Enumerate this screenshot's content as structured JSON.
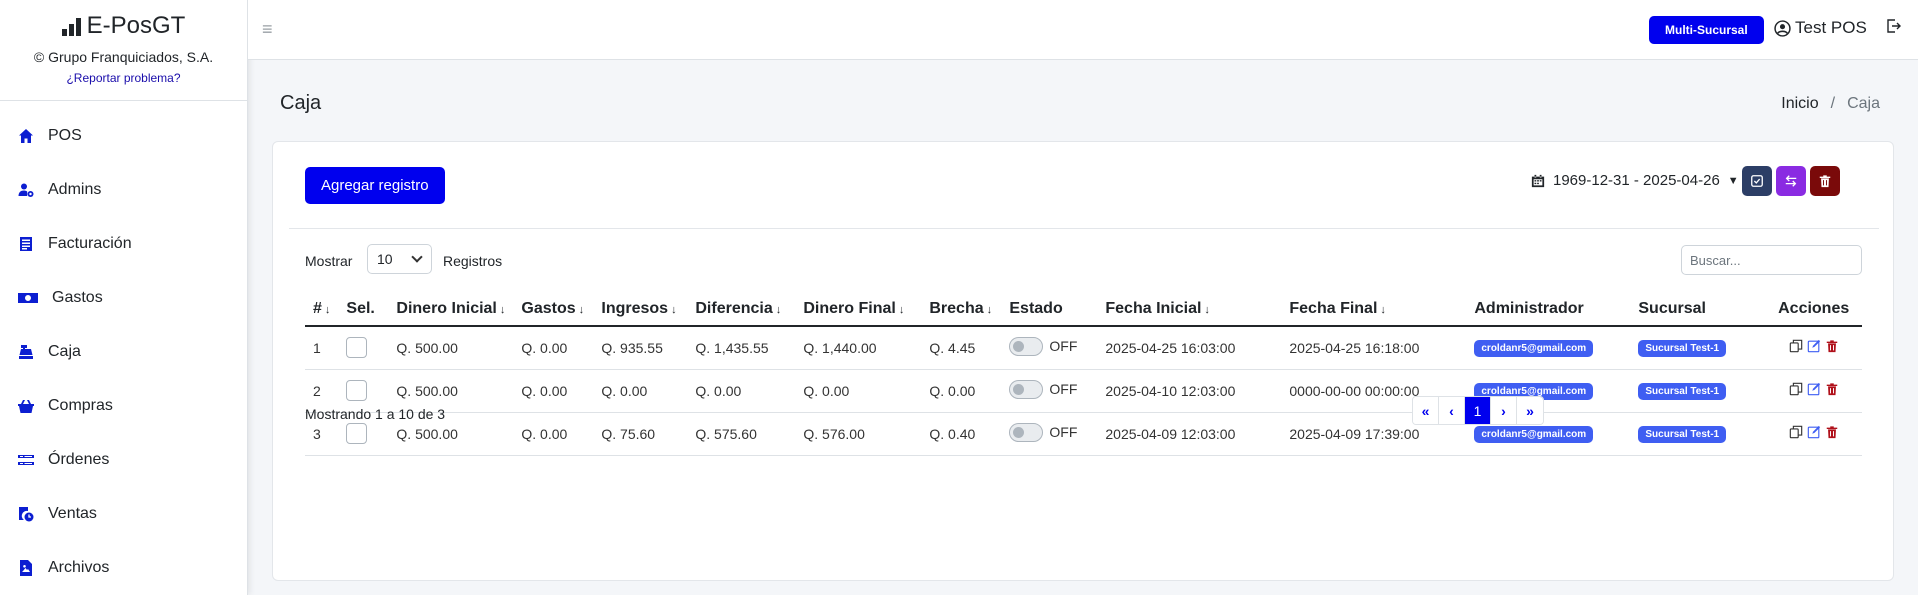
{
  "brand": {
    "name": "E-PosGT",
    "copyright": "© Grupo Franquiciados, S.A.",
    "report_link": "¿Reportar problema?"
  },
  "sidebar": {
    "items": [
      {
        "label": "POS",
        "icon": "home-icon"
      },
      {
        "label": "Admins",
        "icon": "user-gear-icon"
      },
      {
        "label": "Facturación",
        "icon": "invoice-icon"
      },
      {
        "label": "Gastos",
        "icon": "money-icon"
      },
      {
        "label": "Caja",
        "icon": "cash-register-icon"
      },
      {
        "label": "Compras",
        "icon": "basket-icon"
      },
      {
        "label": "Órdenes",
        "icon": "orders-icon"
      },
      {
        "label": "Ventas",
        "icon": "sales-icon"
      },
      {
        "label": "Archivos",
        "icon": "file-image-icon"
      }
    ]
  },
  "header": {
    "multi_branch": "Multi-Sucursal",
    "user": "Test POS"
  },
  "page": {
    "title": "Caja",
    "breadcrumb": {
      "home": "Inicio",
      "sep": "/",
      "current": "Caja"
    }
  },
  "toolbar": {
    "add_label": "Agregar registro",
    "date_range": "1969-12-31 - 2025-04-26"
  },
  "list": {
    "show_label": "Mostrar",
    "page_size": "10",
    "records_label": "Registros",
    "search_placeholder": "Buscar...",
    "showing_text": "Mostrando 1 a 10 de 3"
  },
  "table": {
    "headers": [
      "#",
      "Sel.",
      "Dinero Inicial",
      "Gastos",
      "Ingresos",
      "Diferencia",
      "Dinero Final",
      "Brecha",
      "Estado",
      "Fecha Inicial",
      "Fecha Final",
      "Administrador",
      "Sucursal",
      "Acciones"
    ],
    "rows": [
      {
        "num": "1",
        "initial": "Q. 500.00",
        "expenses": "Q. 0.00",
        "income": "Q. 935.55",
        "difference": "Q. 1,435.55",
        "final": "Q. 1,440.00",
        "gap": "Q. 4.45",
        "state": "OFF",
        "start": "2025-04-25 16:03:00",
        "end": "2025-04-25 16:18:00",
        "admin": "croldanr5@gmail.com",
        "branch": "Sucursal Test-1"
      },
      {
        "num": "2",
        "initial": "Q. 500.00",
        "expenses": "Q. 0.00",
        "income": "Q. 0.00",
        "difference": "Q. 0.00",
        "final": "Q. 0.00",
        "gap": "Q. 0.00",
        "state": "OFF",
        "start": "2025-04-10 12:03:00",
        "end": "0000-00-00 00:00:00",
        "admin": "croldanr5@gmail.com",
        "branch": "Sucursal Test-1"
      },
      {
        "num": "3",
        "initial": "Q. 500.00",
        "expenses": "Q. 0.00",
        "income": "Q. 75.60",
        "difference": "Q. 575.60",
        "final": "Q. 576.00",
        "gap": "Q. 0.40",
        "state": "OFF",
        "start": "2025-04-09 12:03:00",
        "end": "2025-04-09 17:39:00",
        "admin": "croldanr5@gmail.com",
        "branch": "Sucursal Test-1"
      }
    ]
  },
  "pagination": {
    "first": "«",
    "prev": "‹",
    "current": "1",
    "next": "›",
    "last": "»"
  },
  "colors": {
    "primary": "#0000ee",
    "badge": "#3f5ef2",
    "purple": "#8a2be2",
    "dark_red": "#7a0a0a",
    "navy": "#2c3e66"
  }
}
